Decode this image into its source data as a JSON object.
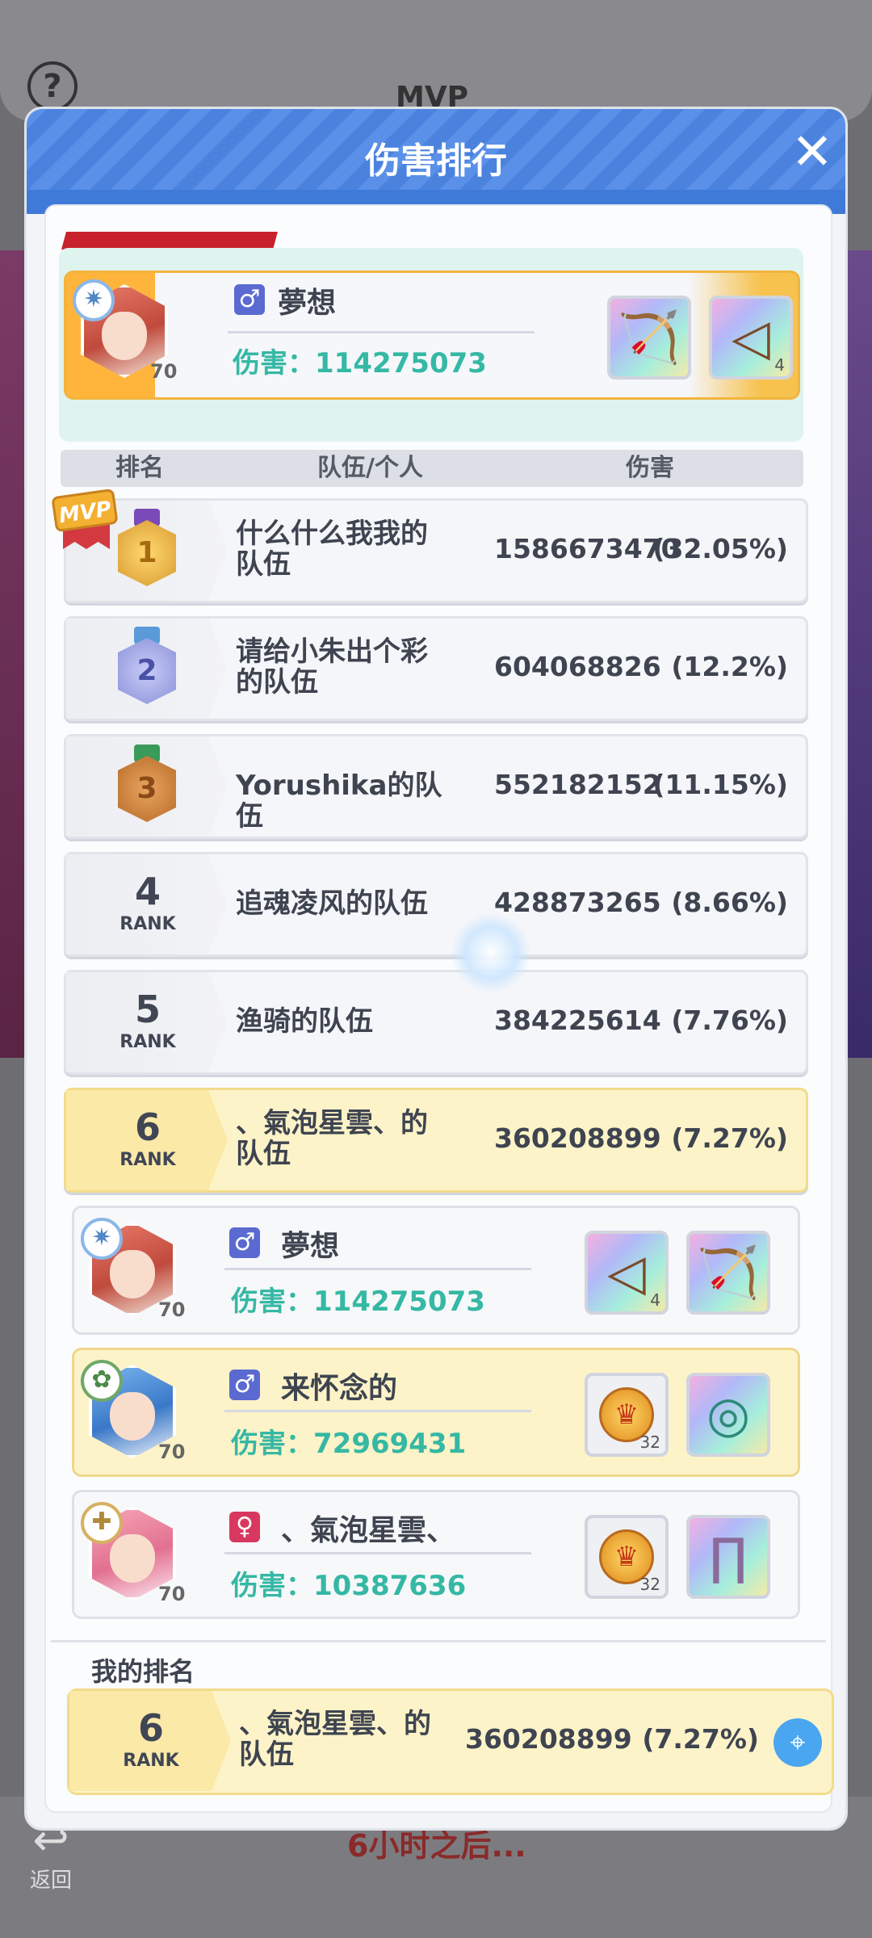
{
  "background": {
    "help_icon": "?",
    "tab_label": "MVP",
    "back_label": "返回",
    "timer_text": "6小时之后..."
  },
  "modal": {
    "title": "伤害排行",
    "close_icon": "✕",
    "colors": {
      "header_blue": "#4a82de",
      "damage_teal": "#35b8a4",
      "highlight_yellow": "#fdf3c8",
      "mvp_red": "#c8222c"
    }
  },
  "mvp": {
    "name": "夢想",
    "gender": "male",
    "gender_icon": "♂",
    "damage_label": "伤害：",
    "damage": "114275073",
    "level": "70",
    "equipment": [
      {
        "icon": "bow-icon",
        "glyph": "🏹",
        "count": ""
      },
      {
        "icon": "triangle-gem-icon",
        "glyph": "◁",
        "count": "4"
      }
    ]
  },
  "table_header": {
    "rank": "排名",
    "team": "队伍/个人",
    "damage": "伤害"
  },
  "rows": [
    {
      "rank": "1",
      "rank_word": "",
      "medal": "gold",
      "team": "什么什么我我的队伍",
      "damage": "1586673470",
      "percent": "(32.05%)",
      "mvp_badge": "MVP"
    },
    {
      "rank": "2",
      "rank_word": "",
      "medal": "silver",
      "team": "请给小朱出个彩的队伍",
      "damage": "604068826",
      "percent": "(12.2%)"
    },
    {
      "rank": "3",
      "rank_word": "",
      "medal": "bronze",
      "team": "Yorushika的队伍",
      "damage": "552182152",
      "percent": "(11.15%)"
    },
    {
      "rank": "4",
      "rank_word": "RANK",
      "team": "追魂凌风的队伍",
      "damage": "428873265",
      "percent": "(8.66%)"
    },
    {
      "rank": "5",
      "rank_word": "RANK",
      "team": "渔骑的队伍",
      "damage": "384225614",
      "percent": "(7.76%)"
    },
    {
      "rank": "6",
      "rank_word": "RANK",
      "team": "、氣泡星雲、的队伍",
      "damage": "360208899",
      "percent": "(7.27%)"
    }
  ],
  "members": [
    {
      "name": "夢想",
      "gender_icon": "♂",
      "damage_label": "伤害：",
      "damage": "114275073",
      "level": "70",
      "equip": [
        {
          "icon": "triangle-gem-icon",
          "glyph": "◁",
          "count": "4"
        },
        {
          "icon": "bow-icon",
          "glyph": "🏹",
          "count": ""
        }
      ]
    },
    {
      "name": "来怀念的",
      "gender_icon": "♂",
      "damage_label": "伤害：",
      "damage": "72969431",
      "level": "70",
      "equip": [
        {
          "icon": "crown-coin-icon",
          "glyph": "♛",
          "count": "32"
        },
        {
          "icon": "ring-icon",
          "glyph": "◎",
          "count": ""
        }
      ]
    },
    {
      "name": "、氣泡星雲、",
      "gender_icon": "♀",
      "damage_label": "伤害：",
      "damage": "10387636",
      "level": "70",
      "equip": [
        {
          "icon": "crown-coin-icon",
          "glyph": "♛",
          "count": "32"
        },
        {
          "icon": "pants-icon",
          "glyph": "∏",
          "count": ""
        }
      ]
    }
  ],
  "my_rank": {
    "label": "我的排名",
    "rank": "6",
    "rank_word": "RANK",
    "team": "、氣泡星雲、的队伍",
    "damage": "360208899",
    "percent": "(7.27%)",
    "locate_icon": "⌖"
  }
}
